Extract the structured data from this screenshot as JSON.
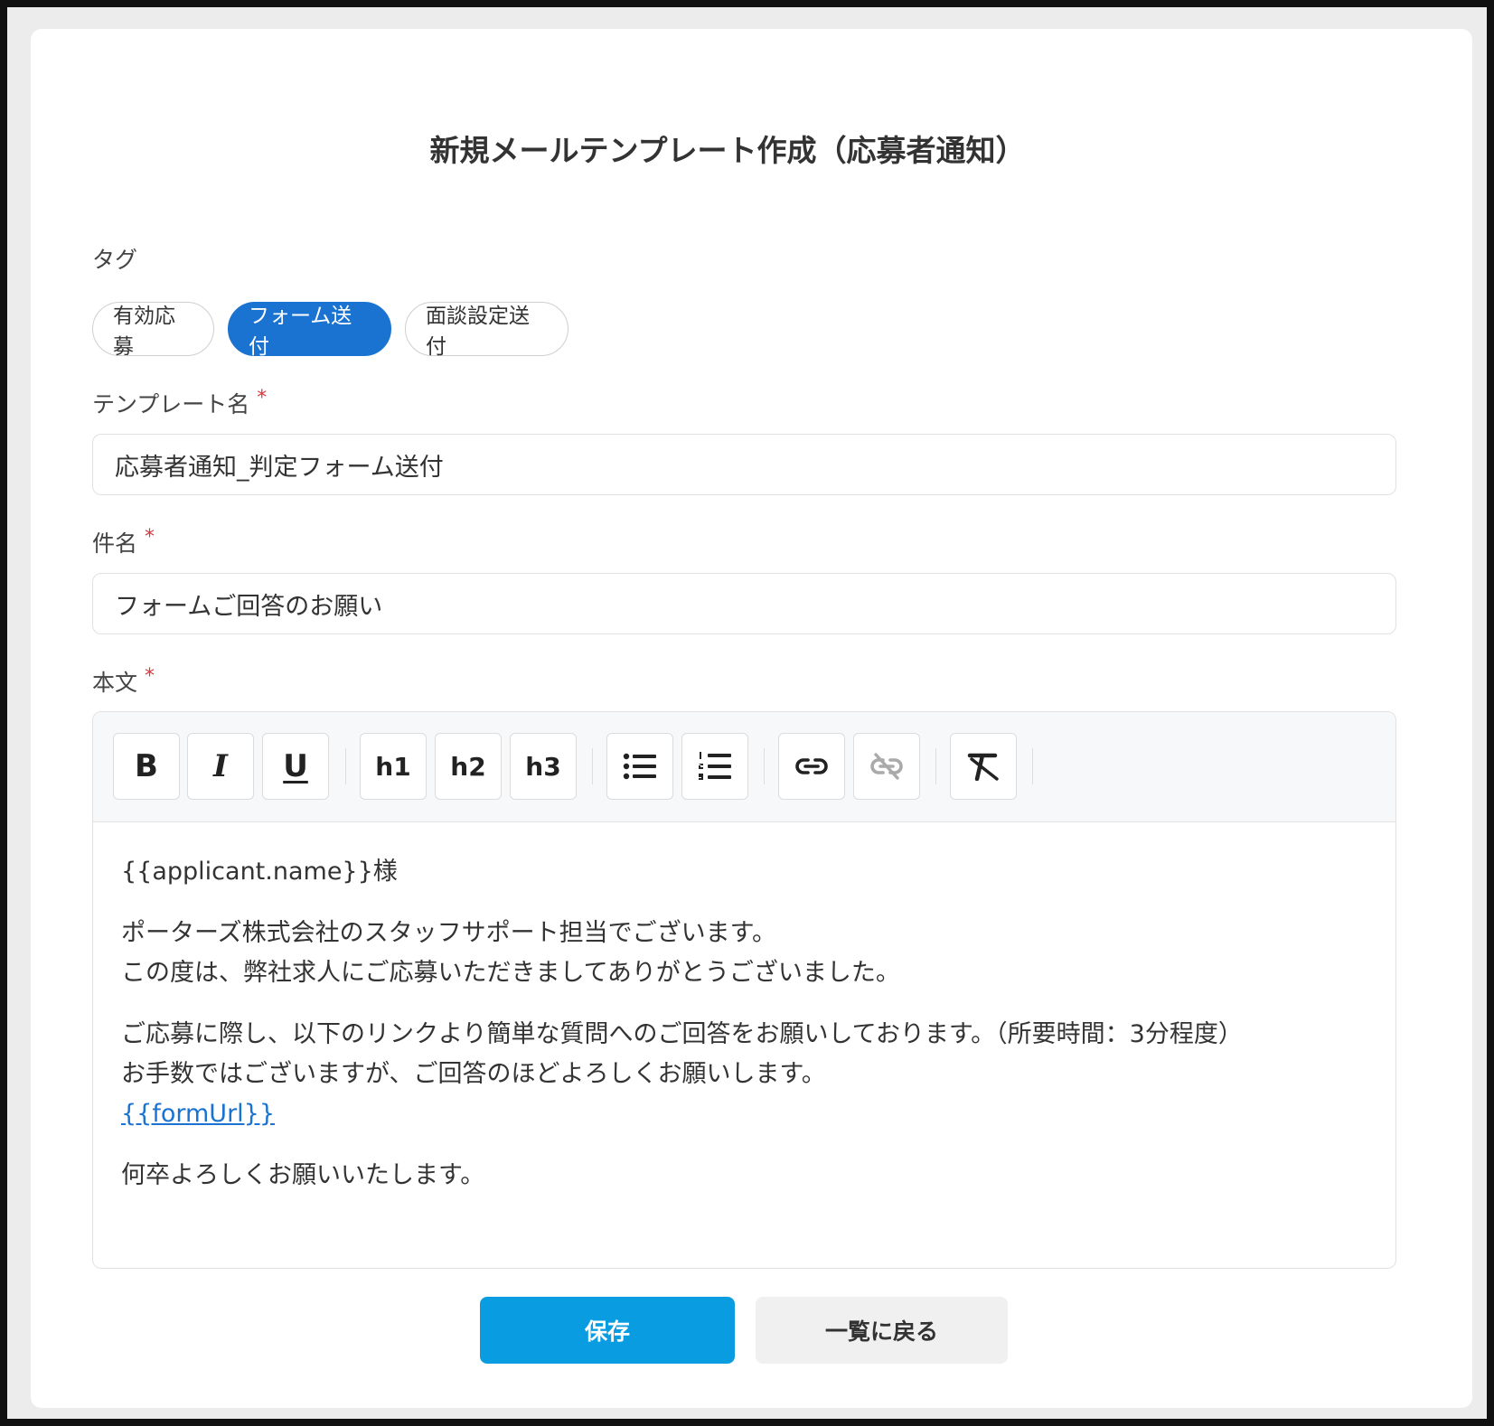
{
  "page": {
    "title": "新規メールテンプレート作成（応募者通知）"
  },
  "tags": {
    "label": "タグ",
    "items": [
      {
        "label": "有効応募",
        "active": false
      },
      {
        "label": "フォーム送付",
        "active": true
      },
      {
        "label": "面談設定送付",
        "active": false
      }
    ]
  },
  "template_name": {
    "label": "テンプレート名",
    "required_mark": "*",
    "value": "応募者通知_判定フォーム送付"
  },
  "subject": {
    "label": "件名",
    "required_mark": "*",
    "value": "フォームご回答のお願い"
  },
  "body": {
    "label": "本文",
    "required_mark": "*",
    "toolbar": {
      "bold": "B",
      "italic": "I",
      "underline": "U",
      "h1": "h1",
      "h2": "h2",
      "h3": "h3"
    },
    "paragraphs": {
      "p1": "{{applicant.name}}様",
      "p2_line1": "ポーターズ株式会社のスタッフサポート担当でございます。",
      "p2_line2": "この度は、弊社求人にご応募いただきましてありがとうございました。",
      "p3_line1": "ご応募に際し、以下のリンクより簡単な質問へのご回答をお願いしております。（所要時間：3分程度）",
      "p3_line2": "お手数ではございますが、ご回答のほどよろしくお願いします。",
      "p3_link": "{{formUrl}}",
      "p4": "何卒よろしくお願いいたします。"
    }
  },
  "actions": {
    "save": "保存",
    "back": "一覧に戻る"
  },
  "colors": {
    "primary": "#1a73d1",
    "save": "#0a9ce0",
    "required": "#d9363e"
  }
}
